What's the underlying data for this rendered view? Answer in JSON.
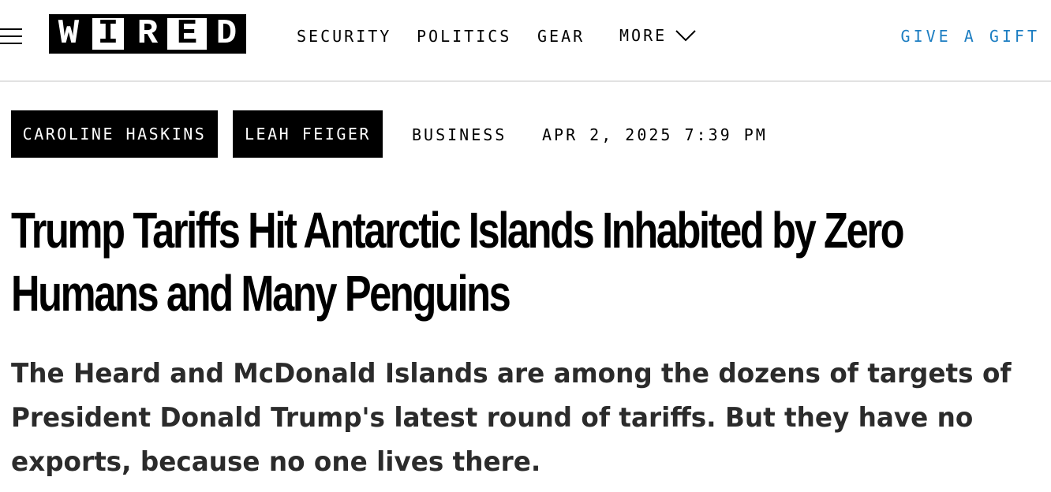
{
  "header": {
    "logo_letters": [
      "W",
      "I",
      "R",
      "E",
      "D"
    ],
    "nav": [
      {
        "label": "SECURITY"
      },
      {
        "label": "POLITICS"
      },
      {
        "label": "GEAR"
      },
      {
        "label": "MORE"
      }
    ],
    "gift_label": "GIVE A GIFT",
    "gift_color": "#1d7ec2"
  },
  "article": {
    "authors": [
      "CAROLINE HASKINS",
      "LEAH FEIGER"
    ],
    "section": "BUSINESS",
    "date": "APR 2, 2025 7:39 PM",
    "headline_lines": [
      "Trump Tariffs Hit Antarctic Islands Inhabited by Zero",
      "Humans and Many Penguins"
    ],
    "dek_lines": [
      "The Heard and McDonald Islands are among the dozens of targets of",
      "President Donald Trump's latest round of tariffs. But they have no",
      "exports, because no one lives there."
    ]
  },
  "icons": {
    "menu": "hamburger-menu-icon",
    "more": "chevron-down-icon"
  }
}
